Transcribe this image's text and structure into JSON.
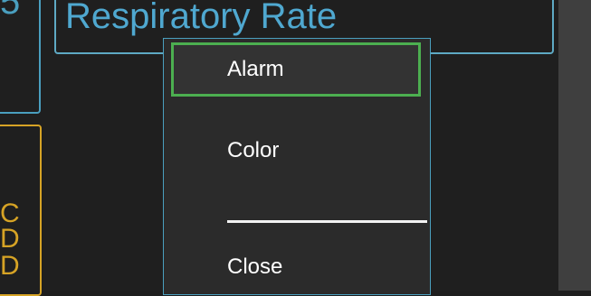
{
  "header": {
    "title": "Respiratory Rate"
  },
  "left_tiles": {
    "teal_fragment": "5",
    "yellow_fragments": [
      "C",
      "D",
      "D"
    ]
  },
  "context_menu": {
    "items": [
      {
        "label": "Alarm",
        "selected": true
      },
      {
        "label": "Color",
        "selected": false
      },
      {
        "label": "Close",
        "selected": false
      }
    ]
  },
  "colors": {
    "accent_teal": "#4a9fbf",
    "accent_yellow": "#d6a325",
    "selection_green": "#4caf50"
  }
}
